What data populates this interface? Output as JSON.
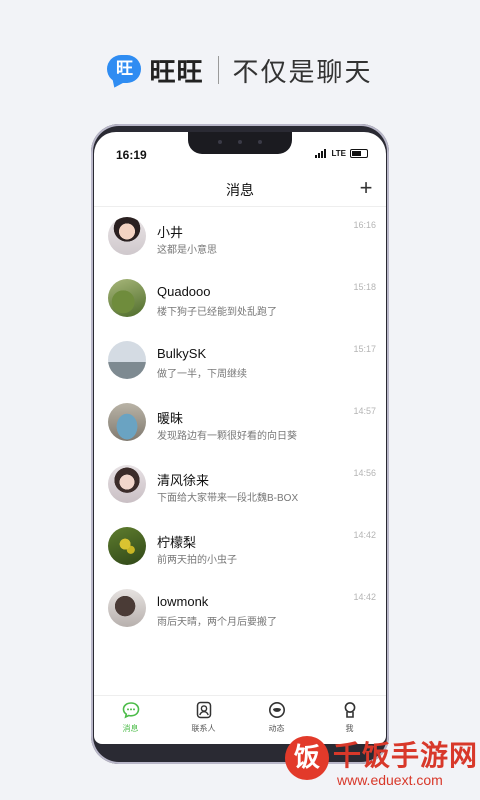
{
  "banner": {
    "logo_char": "旺",
    "app_name": "旺旺",
    "slogan": "不仅是聊天"
  },
  "status_bar": {
    "time": "16:19",
    "network": "LTE"
  },
  "header": {
    "title": "消息",
    "add_label": "+"
  },
  "conversations": [
    {
      "name": "小井",
      "preview": "这都是小意思",
      "time": "16:16"
    },
    {
      "name": "Quadooo",
      "preview": "楼下狗子已经能到处乱跑了",
      "time": "15:18"
    },
    {
      "name": "BulkySK",
      "preview": "做了一半，下周继续",
      "time": "15:17"
    },
    {
      "name": "暖昧",
      "preview": "发现路边有一颗很好看的向日葵",
      "time": "14:57"
    },
    {
      "name": "清风徐来",
      "preview": "下面给大家带来一段北魏B-BOX",
      "time": "14:56"
    },
    {
      "name": "柠檬梨",
      "preview": "前两天拍的小虫子",
      "time": "14:42"
    },
    {
      "name": "lowmonk",
      "preview": "雨后天晴，两个月后要搬了",
      "time": "14:42"
    }
  ],
  "tabs": [
    {
      "label": "消息",
      "icon": "chat-icon",
      "active": true
    },
    {
      "label": "联系人",
      "icon": "contacts-icon",
      "active": false
    },
    {
      "label": "动态",
      "icon": "moments-icon",
      "active": false
    },
    {
      "label": "我",
      "icon": "profile-icon",
      "active": false
    }
  ],
  "watermark": {
    "logo_char": "饭",
    "text": "千饭手游网",
    "url": "www.eduext.com"
  },
  "colors": {
    "accent_green": "#4cbc49",
    "brand_blue": "#2f8cf2",
    "watermark_red": "#d8382a"
  }
}
